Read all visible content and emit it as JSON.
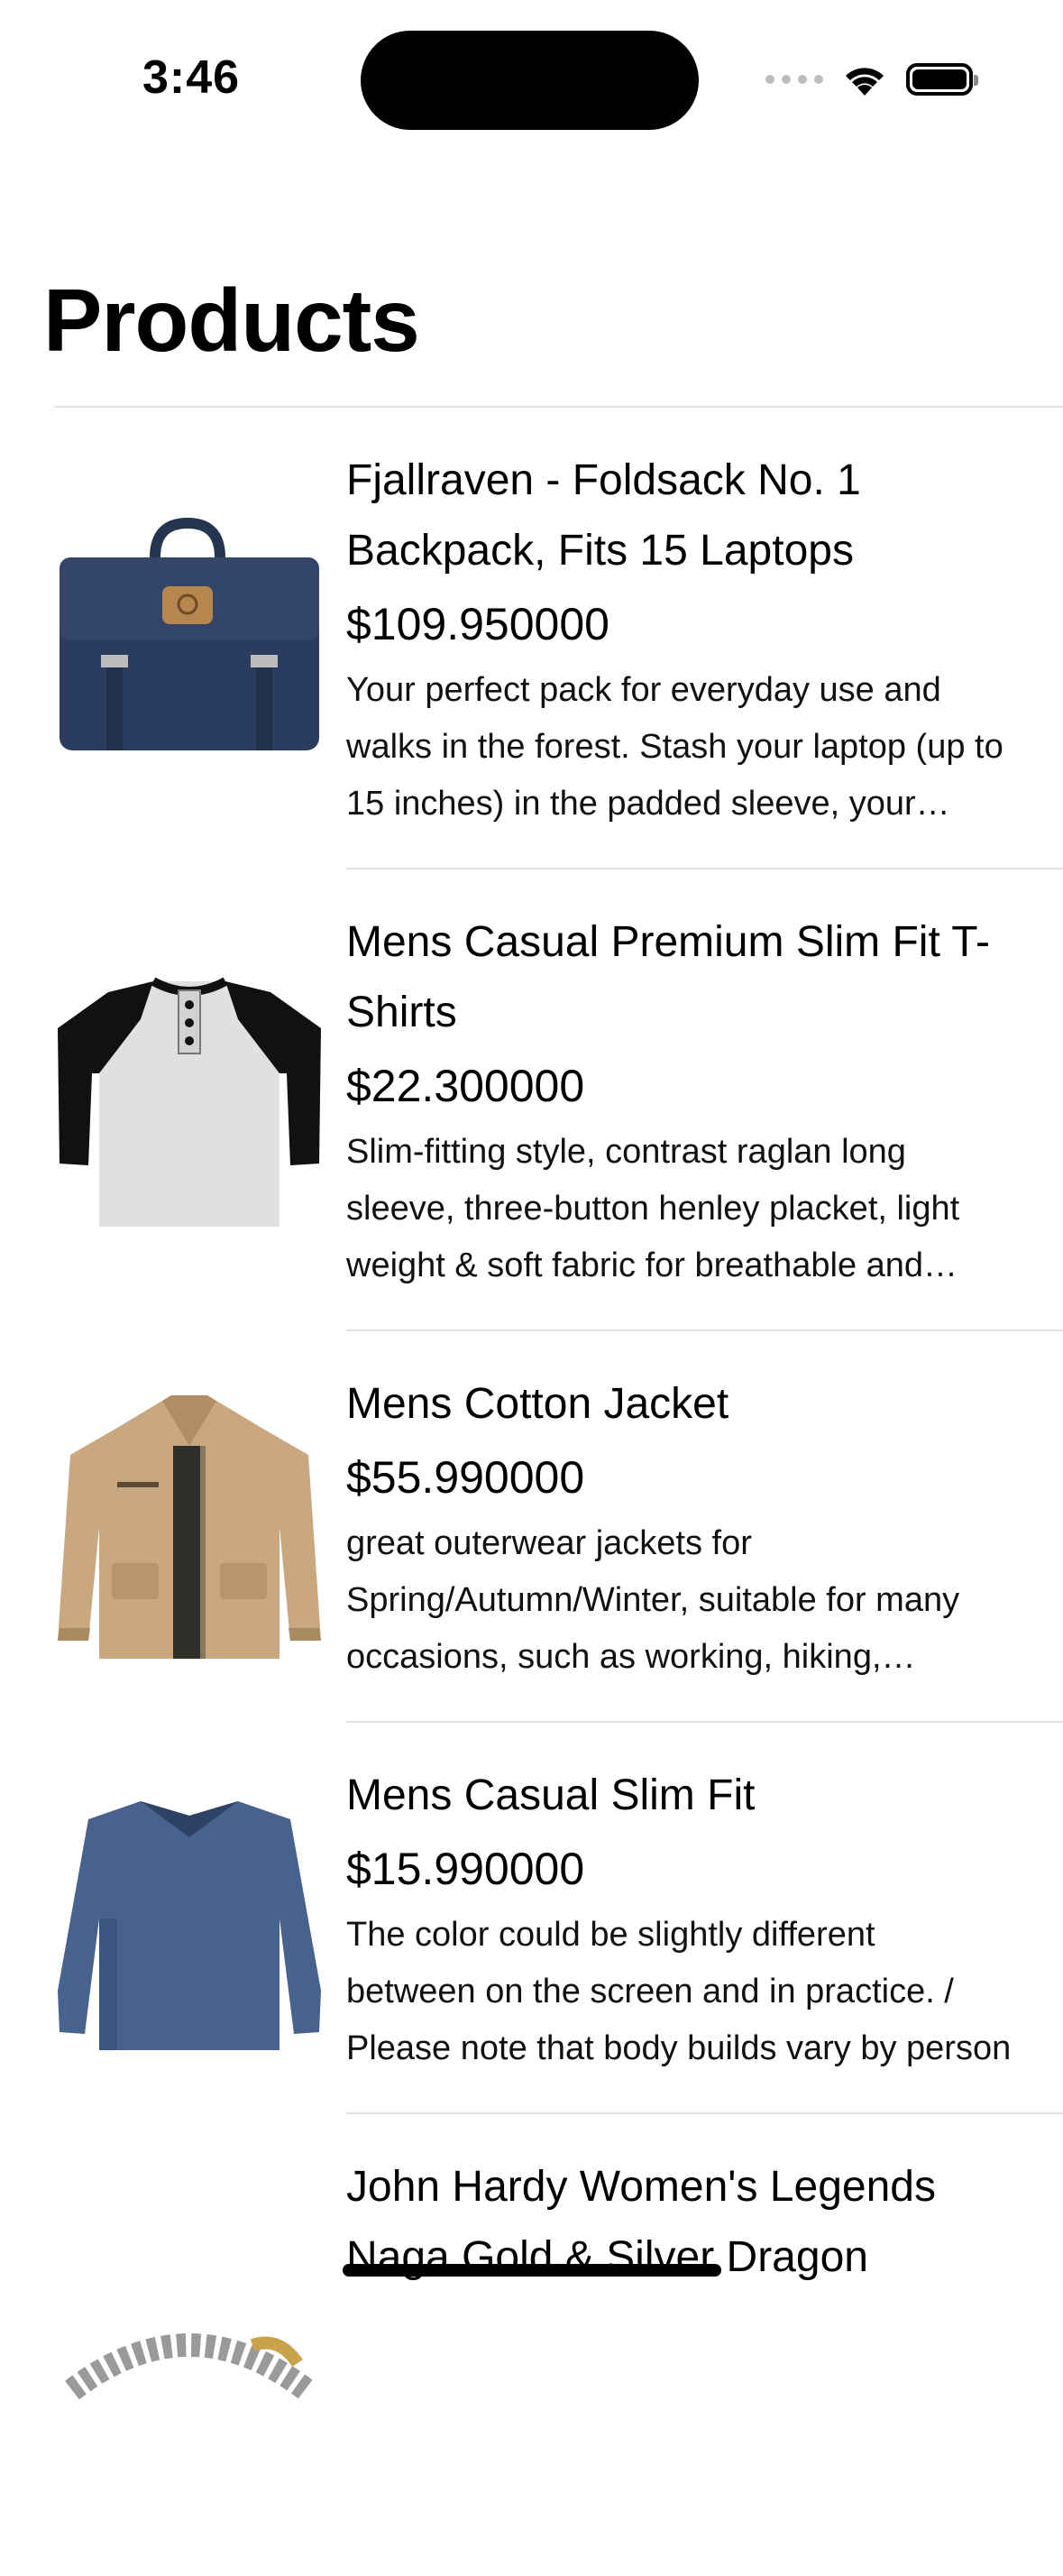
{
  "status_bar": {
    "time": "3:46",
    "icons": [
      "signal-dots-icon",
      "wifi-icon",
      "battery-icon"
    ]
  },
  "title": "Products",
  "products": [
    {
      "title": "Fjallraven - Foldsack No. 1 Backpack, Fits 15 Laptops",
      "price": "$109.950000",
      "description": "Your perfect pack for everyday use and walks in the forest. Stash your laptop (up to 15 inches) in the padded sleeve, your everyday",
      "image": "backpack-image"
    },
    {
      "title": "Mens Casual Premium Slim Fit T-Shirts",
      "price": "$22.300000",
      "description": "Slim-fitting style, contrast raglan long sleeve, three-button henley placket, light weight & soft fabric for breathable and comfortable wearing.",
      "image": "tshirt-image"
    },
    {
      "title": "Mens Cotton Jacket",
      "price": "$55.990000",
      "description": "great outerwear jackets for Spring/Autumn/Winter, suitable for many occasions, such as working, hiking, camping",
      "image": "jacket-image"
    },
    {
      "title": "Mens Casual Slim Fit",
      "price": "$15.990000",
      "description": "The color could be slightly different between on the screen and in practice. / Please note that body builds vary by person",
      "image": "longsleeve-image"
    },
    {
      "title": "John Hardy Women's Legends Naga Gold & Silver Dragon",
      "image": "bracelet-image"
    }
  ],
  "colors": {
    "divider": "#e2e2e2",
    "backpack": "#2b3d5e",
    "jacket": "#c9a77f",
    "longsleeve": "#47628f"
  }
}
